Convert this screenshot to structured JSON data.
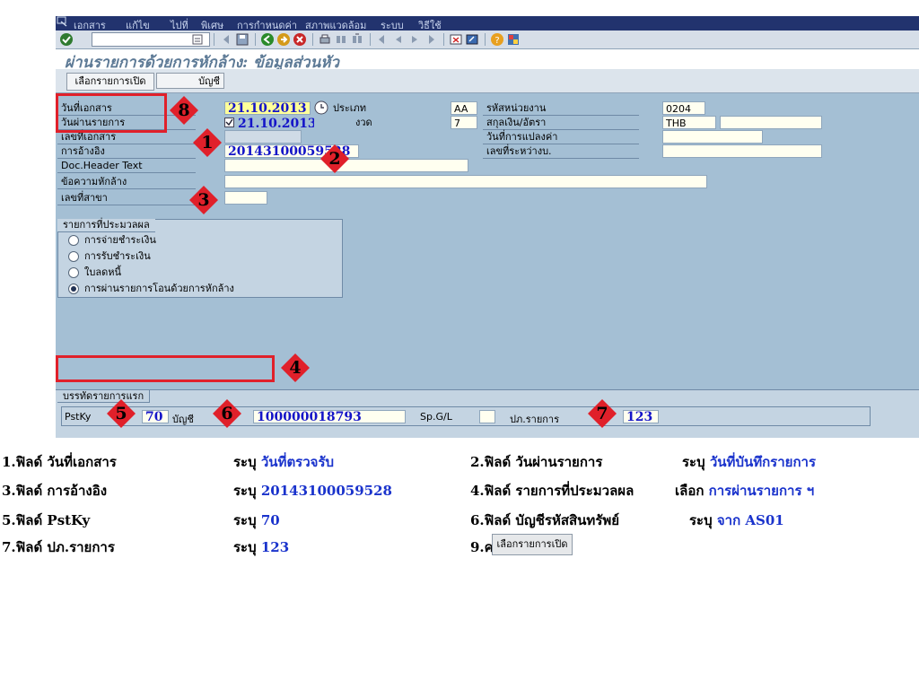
{
  "menu": [
    "เอกสาร",
    "แก้ไข",
    "ไปที่",
    "พิเศษ",
    "การกำหนดค่า",
    "สภาพแวดล้อม",
    "ระบบ",
    "วิธีใช้"
  ],
  "screen_title": "ผ่านรายการด้วยการหักล้าง: ข้อมูลส่วนหัว",
  "buttons": {
    "open_items": "เลือกรายการเปิด",
    "account_partial": "บัญชี"
  },
  "fields": {
    "doc_date": {
      "label": "วันที่เอกสาร",
      "value": "21.10.2013"
    },
    "type": {
      "label": "ประเภท",
      "value": "AA"
    },
    "company_code": {
      "label": "รหัสหน่วยงาน",
      "value": "0204"
    },
    "posting_date": {
      "label": "วันผ่านรายการ",
      "value": "21.10.2013"
    },
    "period": {
      "label": "งวด",
      "value": "7"
    },
    "currency": {
      "label": "สกุลเงิน/อัตรา",
      "value": "THB"
    },
    "doc_number": {
      "label": "เลขที่เอกสาร",
      "value": ""
    },
    "translation_date": {
      "label": "วันที่การแปลงค่า",
      "value": ""
    },
    "reference": {
      "label": "การอ้างอิง",
      "value": "20143100059528"
    },
    "intercompany": {
      "label": "เลขที่ระหว่างบ.",
      "value": ""
    },
    "header_text": {
      "label": "Doc.Header Text",
      "value": ""
    },
    "clearing_text": {
      "label": "ข้อความหักล้าง",
      "value": ""
    },
    "branch": {
      "label": "เลขที่สาขา",
      "value": ""
    }
  },
  "processing": {
    "title": "รายการที่ประมวลผล",
    "options": [
      {
        "label": "การจ่ายชำระเงิน",
        "selected": false
      },
      {
        "label": "การรับชำระเงิน",
        "selected": false
      },
      {
        "label": "ใบลดหนี้",
        "selected": false
      },
      {
        "label": "การผ่านรายการโอนด้วยการหักล้าง",
        "selected": true
      }
    ]
  },
  "first_line": {
    "title": "บรรทัดรายการแรก",
    "pstky_label": "PstKy",
    "pstky_value": "70",
    "account_label": "บัญชี",
    "account_value": "100000018793",
    "spgl_label": "Sp.G/L",
    "trans_type_label": "ปภ.รายการ",
    "trans_type_value": "123"
  },
  "badges": [
    "1",
    "2",
    "3",
    "4",
    "5",
    "6",
    "7",
    "8"
  ],
  "instructions": [
    {
      "n": "1.ฟิลด์ วันที่เอกสาร",
      "verb": "ระบุ",
      "v": "วันที่ตรวจรับ"
    },
    {
      "n": "2.ฟิลด์ วันผ่านรายการ",
      "verb": "ระบุ",
      "v": "วันที่บันทึกรายการ"
    },
    {
      "n": "3.ฟิลด์ การอ้างอิง",
      "verb": "ระบุ",
      "v": "20143100059528"
    },
    {
      "n": "4.ฟิลด์ รายการที่ประมวลผล",
      "verb": "เลือก",
      "v": "การผ่านรายการ ฯ"
    },
    {
      "n": "5.ฟิลด์ PstKy",
      "verb": "ระบุ",
      "v": "70"
    },
    {
      "n": "6.ฟิลด์ บัญชีรหัสสินทรัพย์",
      "verb": "ระบุ",
      "v": "จาก AS01"
    },
    {
      "n": "7.ฟิลด์ ปภ.รายการ",
      "verb": "ระบุ",
      "v": "123"
    },
    {
      "n": "9.คลิก",
      "button": "เลือกรายการเปิด"
    }
  ],
  "colors": {
    "accent_value": "#1a33cc",
    "callout_red": "#e0202a"
  }
}
